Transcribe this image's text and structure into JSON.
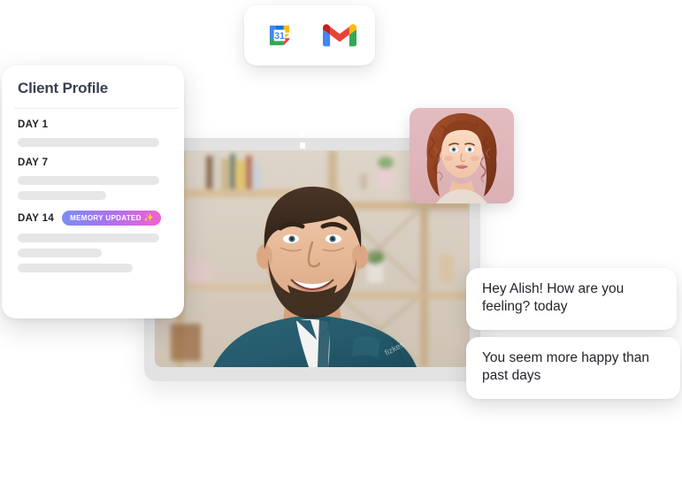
{
  "integrations": {
    "name": "integrations-card",
    "apps": [
      {
        "id": "google-calendar",
        "label": "Google Calendar",
        "day_number": "31"
      },
      {
        "id": "gmail",
        "label": "Gmail"
      }
    ]
  },
  "profile": {
    "title": "Client Profile",
    "entries": [
      {
        "day_label": "DAY 1",
        "badge": null,
        "bars": [
          160
        ]
      },
      {
        "day_label": "DAY 7",
        "badge": null,
        "bars": [
          160,
          100
        ]
      },
      {
        "day_label": "DAY 14",
        "badge": {
          "text": "MEMORY UPDATED",
          "sparkle": "✨",
          "gradient_from": "#7b8ef0",
          "gradient_to": "#f45fd4"
        },
        "bars": [
          160,
          95,
          130
        ]
      }
    ]
  },
  "video": {
    "name": "video-call-frame",
    "participant": "smiling bearded man in teal shirt",
    "watermark": "fizkes"
  },
  "avatar": {
    "name": "ai-avatar-thumbnail",
    "description": "woman with curly auburn hair on pink background"
  },
  "messages": [
    {
      "text": "Hey Alish! How are you feeling? today"
    },
    {
      "text": "You seem more happy than past days"
    }
  ],
  "connectors": [
    {
      "id": "video-to-integrations",
      "direction": "up",
      "style": "dashed-arrow",
      "color": "#ffffff"
    },
    {
      "id": "avatar-to-message",
      "direction": "right-down",
      "style": "dashed-arrow",
      "color": "#ffffff"
    }
  ]
}
